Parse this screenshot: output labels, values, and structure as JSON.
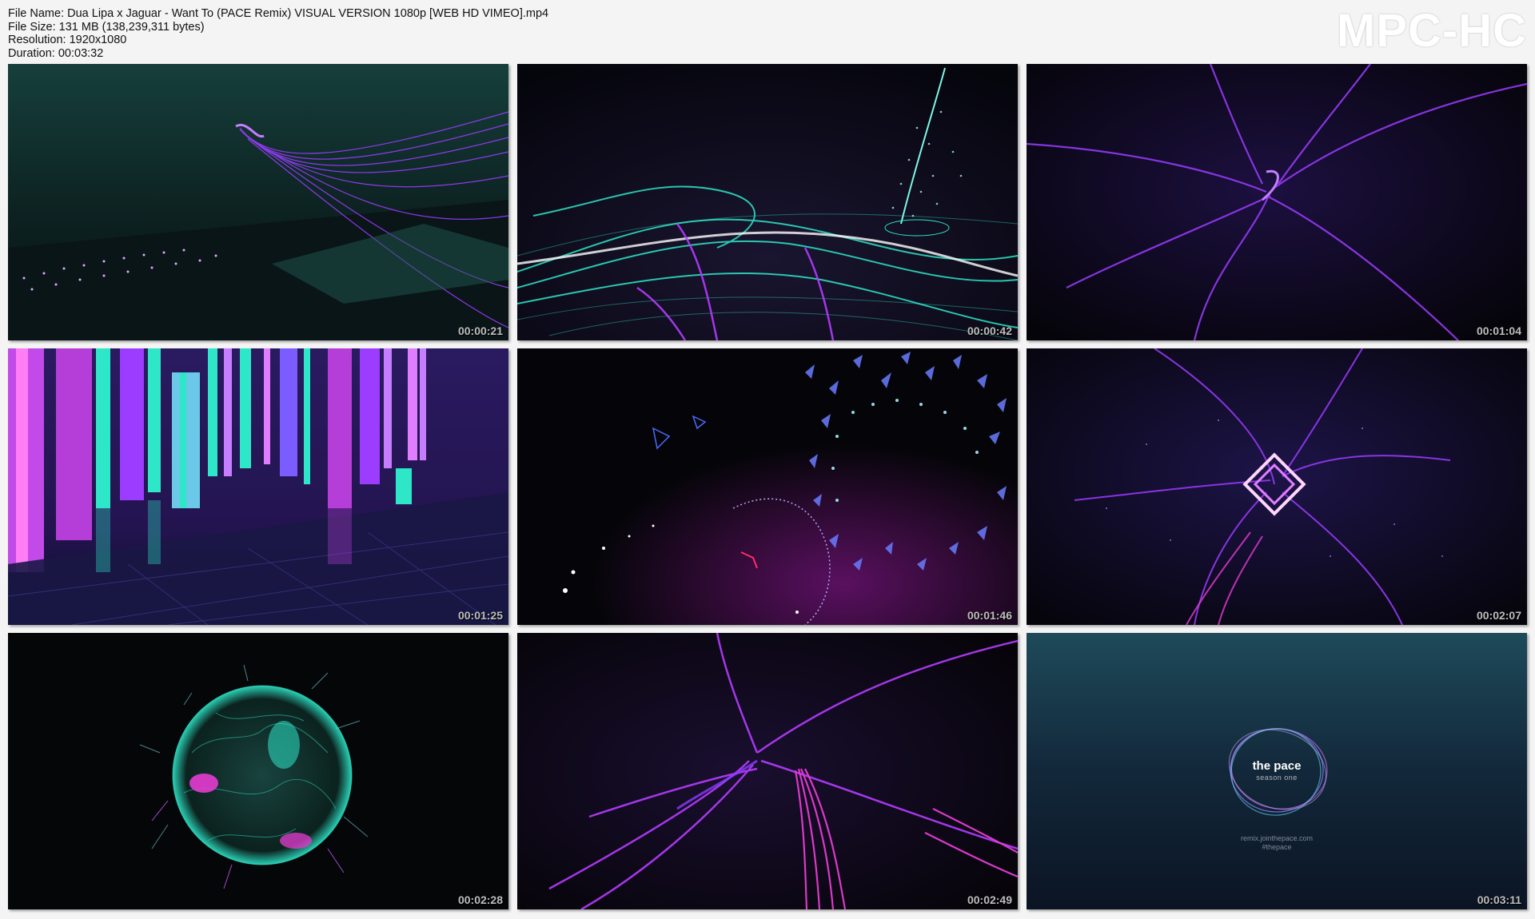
{
  "file_info": {
    "name_line": "File Name: Dua Lipa x Jaguar - Want To (PACE Remix) VISUAL VERSION 1080p [WEB HD VIMEO].mp4",
    "size_line": "File Size: 131 MB (138,239,311 bytes)",
    "resolution_line": "Resolution: 1920x1080",
    "duration_line": "Duration: 00:03:32"
  },
  "logo": "MPC-HC",
  "thumbnails": [
    {
      "timestamp": "00:00:21",
      "scene": "purple-ribbon-over-teal-grid"
    },
    {
      "timestamp": "00:00:42",
      "scene": "cyan-swirling-particle-streams"
    },
    {
      "timestamp": "00:01:04",
      "scene": "purple-vortex-lines"
    },
    {
      "timestamp": "00:01:25",
      "scene": "neon-pillars-room"
    },
    {
      "timestamp": "00:01:46",
      "scene": "blue-shard-tunnel"
    },
    {
      "timestamp": "00:02:07",
      "scene": "glowing-square-vortex"
    },
    {
      "timestamp": "00:02:28",
      "scene": "teal-sphere-with-tendrils"
    },
    {
      "timestamp": "00:02:49",
      "scene": "magenta-vortex-streaks"
    },
    {
      "timestamp": "00:03:11",
      "scene": "the-pace-end-card"
    }
  ],
  "end_card": {
    "title": "the pace",
    "subtitle": "season one",
    "url": "remix.jointhepace.com",
    "hashtag": "#thepace"
  },
  "colors": {
    "background": "#f4f4f4",
    "purple": "#9b3cff",
    "cyan": "#2ee6c8",
    "magenta": "#e63cd2"
  }
}
